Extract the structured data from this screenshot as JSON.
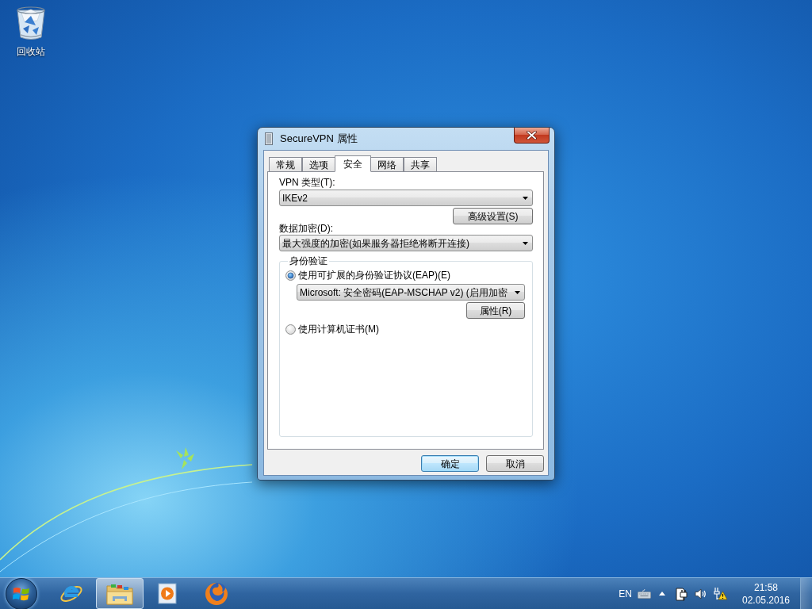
{
  "desktop": {
    "icons": [
      {
        "label": "回收站"
      }
    ]
  },
  "dialog": {
    "title": "SecureVPN 属性",
    "tabs": [
      {
        "label": "常规",
        "selected": false
      },
      {
        "label": "选项",
        "selected": false
      },
      {
        "label": "安全",
        "selected": true
      },
      {
        "label": "网络",
        "selected": false
      },
      {
        "label": "共享",
        "selected": false
      }
    ],
    "vpn_type": {
      "label": "VPN 类型(T):",
      "value": "IKEv2"
    },
    "advanced_button": "高级设置(S)",
    "encryption": {
      "label": "数据加密(D):",
      "value": "最大强度的加密(如果服务器拒绝将断开连接)"
    },
    "authentication": {
      "title": "身份验证",
      "options": [
        {
          "label": "使用可扩展的身份验证协议(EAP)(E)",
          "selected": true,
          "method": "Microsoft: 安全密码(EAP-MSCHAP v2) (启用加密",
          "button": "属性(R)"
        },
        {
          "label": "使用计算机证书(M)",
          "selected": false
        }
      ]
    },
    "buttons": [
      {
        "label": "确定",
        "default": true
      },
      {
        "label": "取消",
        "default": false
      }
    ]
  },
  "taskbar": {
    "apps": [
      {
        "kind": "ie",
        "selected": false
      },
      {
        "kind": "folder",
        "selected": true
      },
      {
        "kind": "player",
        "selected": false
      },
      {
        "kind": "firefox",
        "selected": false
      }
    ],
    "language": "EN",
    "time": "21:58",
    "date": "02.05.2016"
  }
}
